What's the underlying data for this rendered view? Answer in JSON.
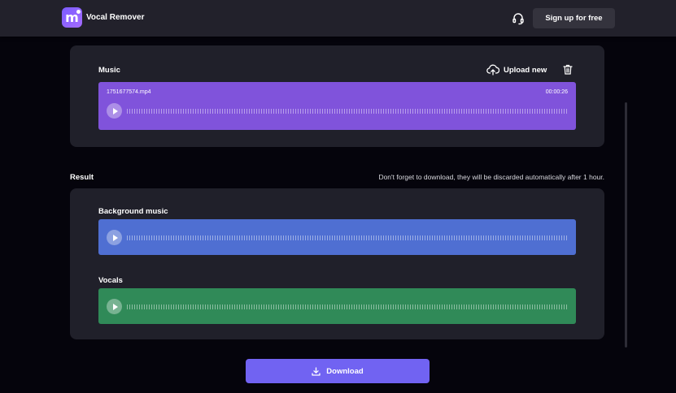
{
  "header": {
    "app_title": "Vocal Remover",
    "logo_letter": "m",
    "signup_label": "Sign up for free",
    "support_icon": "headset-icon"
  },
  "music": {
    "label": "Music",
    "upload_label": "Upload new",
    "upload_icon": "cloud-upload-icon",
    "delete_icon": "trash-icon",
    "file_name": "1751677574.mp4",
    "duration": "00:00:26",
    "color": "#8053db"
  },
  "result": {
    "title": "Result",
    "notice": "Don't forget to download, they will be discarded automatically after 1 hour.",
    "tracks": [
      {
        "label": "Background music",
        "color": "#4f6fd2"
      },
      {
        "label": "Vocals",
        "color": "#308a58"
      }
    ]
  },
  "download": {
    "label": "Download",
    "icon": "download-icon",
    "color": "#7163f2"
  }
}
